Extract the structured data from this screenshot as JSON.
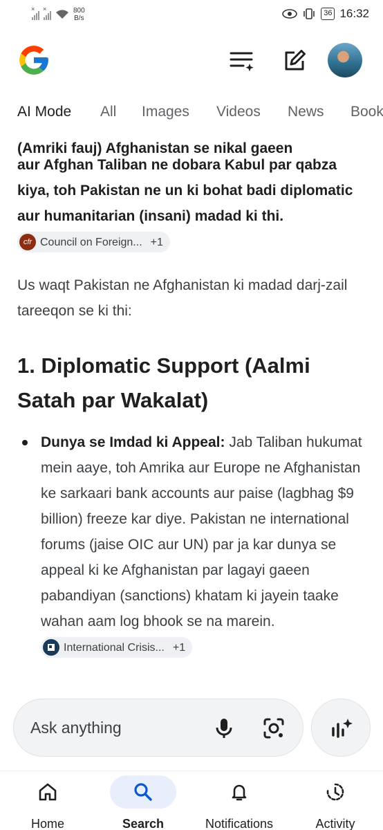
{
  "status_bar": {
    "net_speed_value": "800",
    "net_speed_unit": "B/s",
    "battery": "36",
    "time": "16:32"
  },
  "header": {
    "logo": "google-g-logo",
    "icons": [
      "history-sparkle-icon",
      "edit-icon"
    ]
  },
  "tabs": [
    {
      "label": "AI Mode",
      "active": true
    },
    {
      "label": "All"
    },
    {
      "label": "Images"
    },
    {
      "label": "Videos"
    },
    {
      "label": "News"
    },
    {
      "label": "Books"
    }
  ],
  "content": {
    "clipped_line": "(Amriki fauj) Afghanistan se nikal gaeen",
    "intro_bold": "aur Afghan Taliban ne dobara Kabul par qabza kiya, toh Pakistan ne un ki bohat badi diplomatic aur humanitarian (insani) madad ki thi.",
    "source_chip_1": {
      "label": "Council on Foreign...",
      "more": "+1",
      "logo": "cfr",
      "color": "#8b2e12"
    },
    "paragraph_1": "Us waqt Pakistan ne Afghanistan ki madad darj-zail tareeqon se ki thi:",
    "heading_1": "1. Diplomatic Support (Aalmi Satah par Wakalat)",
    "bullet_1": {
      "title": "Dunya se Imdad ki Appeal:",
      "text": "Jab Taliban hukumat mein aaye, toh Amrika aur Europe ne Afghanistan ke sarkaari bank accounts aur paise (lagbhag $9 billion) freeze kar diye. Pakistan ne international forums (jaise OIC aur UN) par ja kar dunya se appeal ki ke Afghanistan par lagayi gaeen pabandiyan (sanctions) khatam ki jayein taake wahan aam log bhook se na marein.",
      "source_chip": {
        "label": "International Crisis...",
        "more": "+1",
        "color": "#1a3a5a"
      }
    }
  },
  "search": {
    "placeholder": "Ask anything",
    "icons": [
      "mic-icon",
      "google-lens-icon",
      "ai-mode-sparkle-icon"
    ]
  },
  "bottom_nav": [
    {
      "label": "Home",
      "icon": "home-icon"
    },
    {
      "label": "Search",
      "icon": "search-icon",
      "active": true
    },
    {
      "label": "Notifications",
      "icon": "bell-icon"
    },
    {
      "label": "Activity",
      "icon": "activity-icon"
    }
  ]
}
